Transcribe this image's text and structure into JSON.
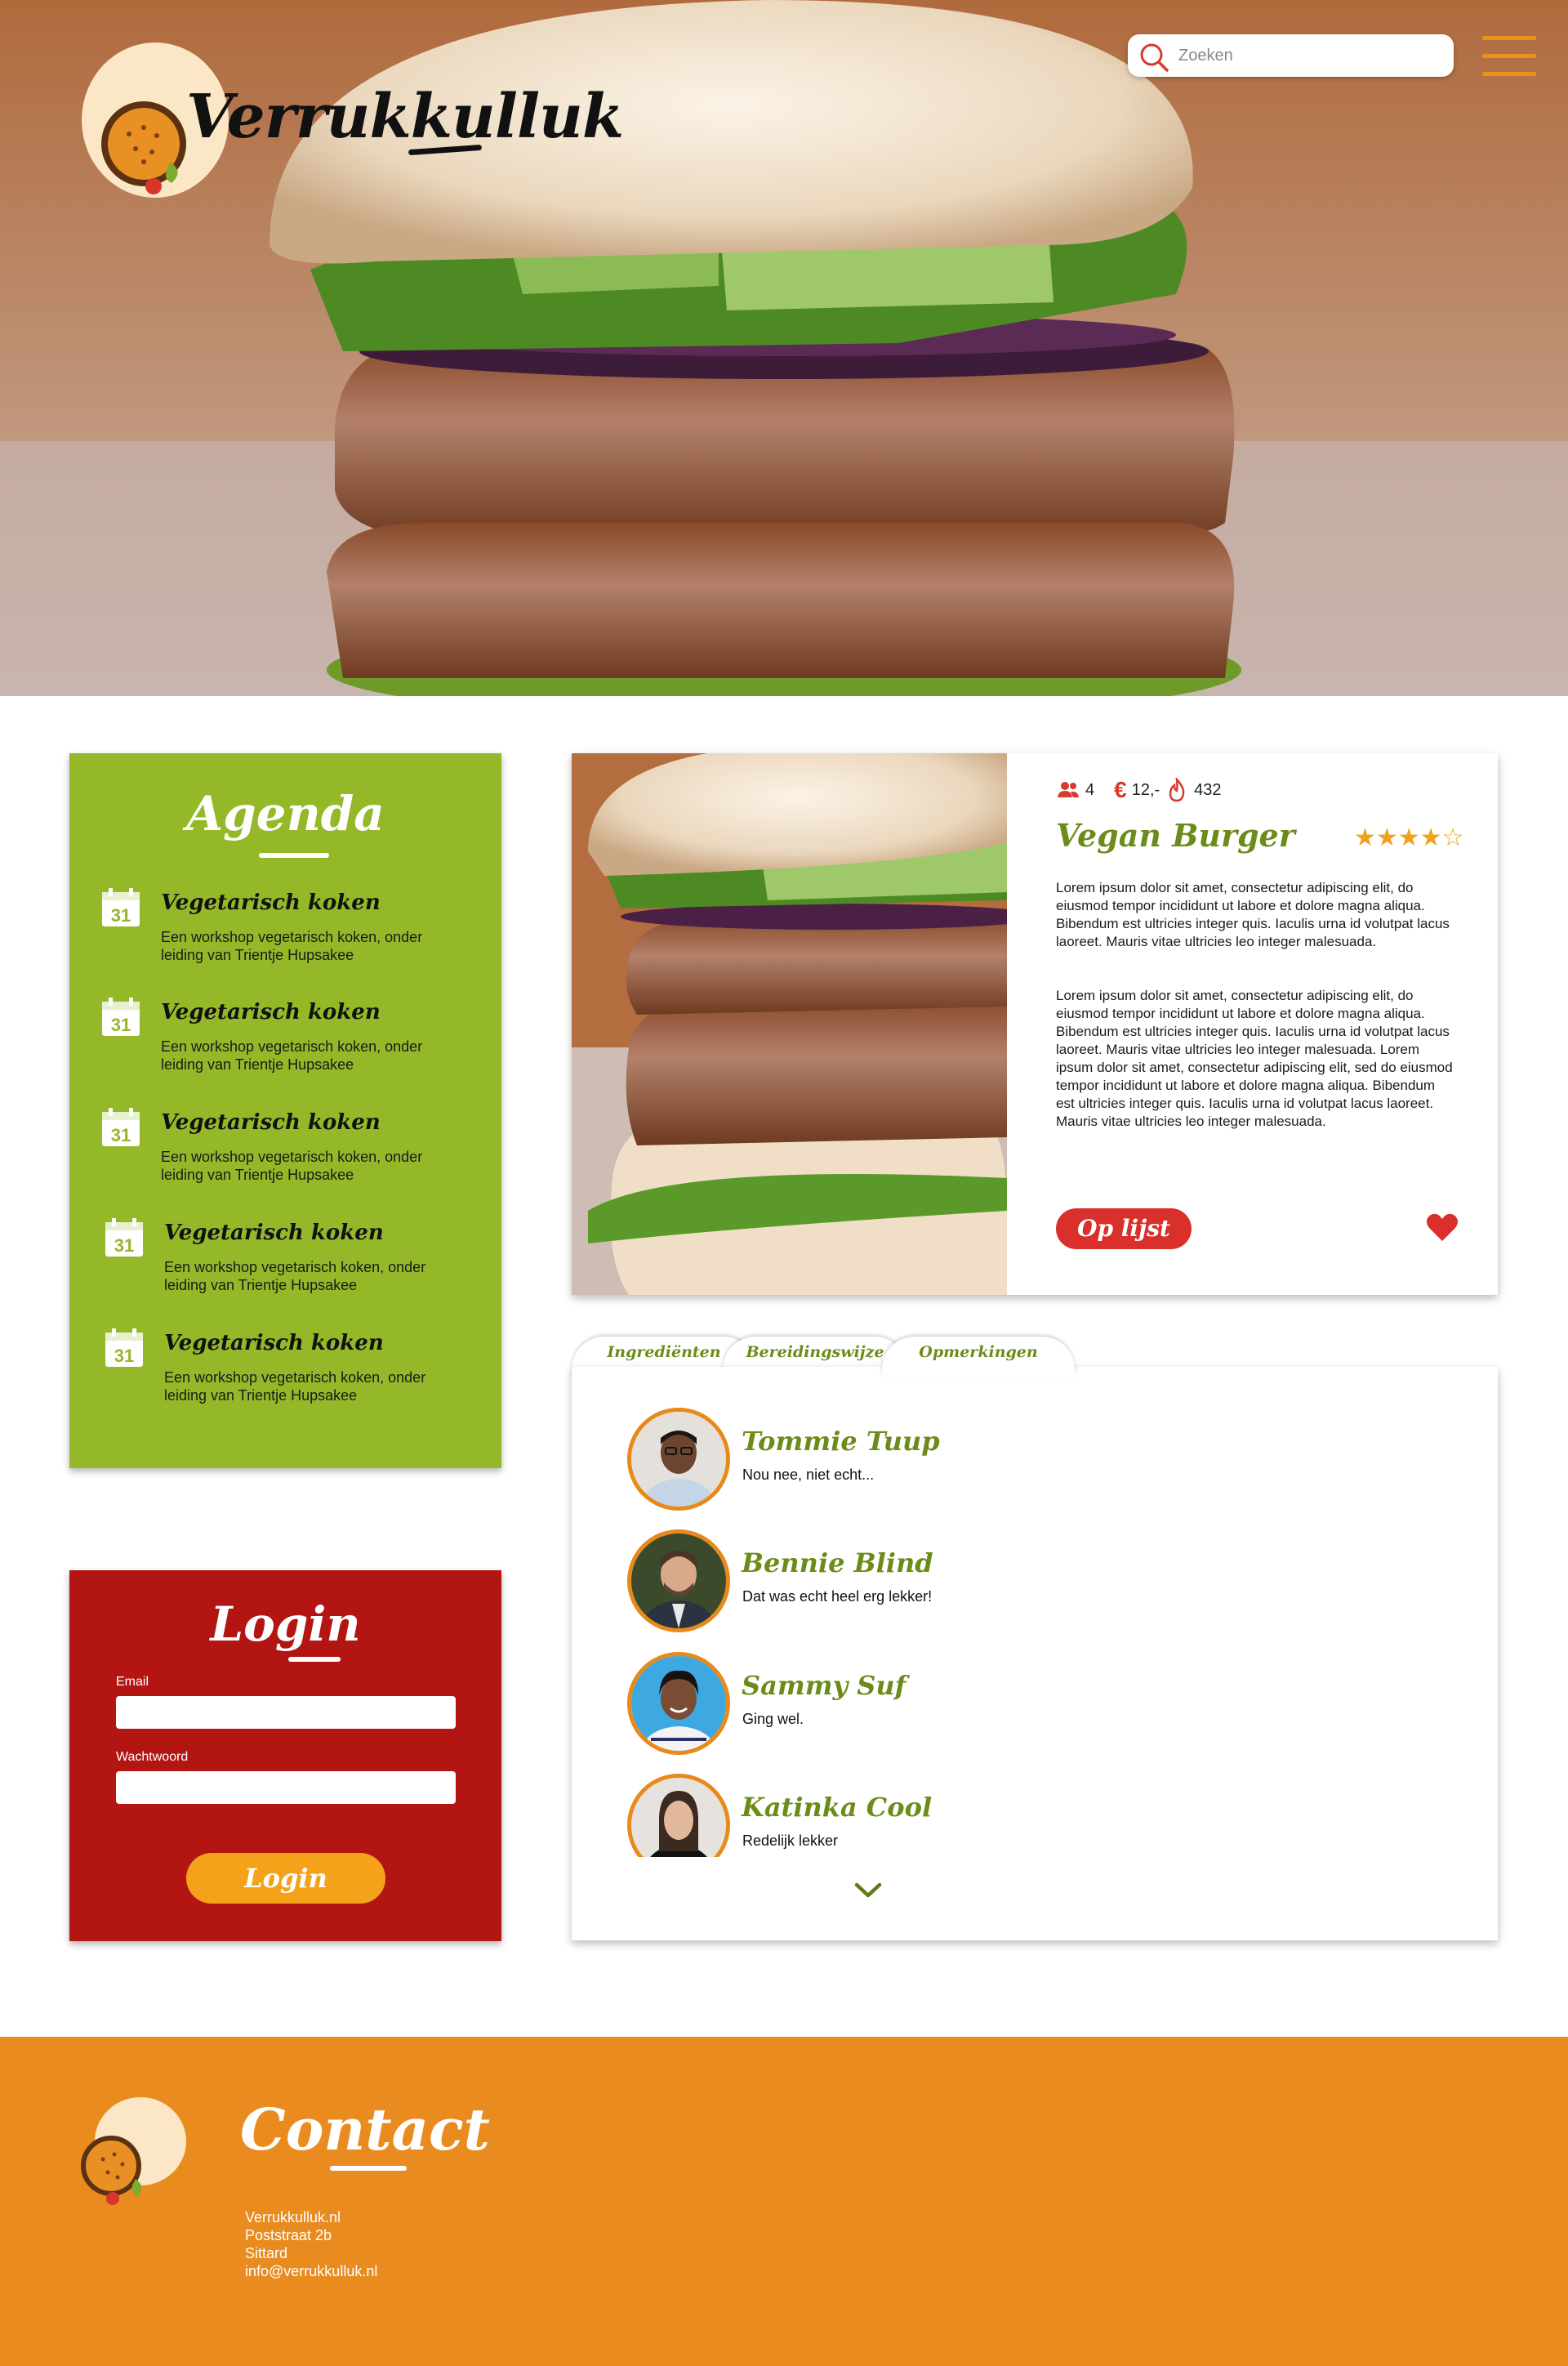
{
  "header": {
    "logo_text": "Verrukkulluk",
    "search_placeholder": "Zoeken"
  },
  "agenda": {
    "title": "Agenda",
    "items": [
      {
        "day": "31",
        "title": "Vegetarisch koken",
        "description": "Een workshop vegetarisch koken, onder leiding van Trientje Hupsakee"
      },
      {
        "day": "31",
        "title": "Vegetarisch koken",
        "description": "Een workshop vegetarisch koken, onder leiding van Trientje Hupsakee"
      },
      {
        "day": "31",
        "title": "Vegetarisch koken",
        "description": "Een workshop vegetarisch koken, onder leiding van Trientje Hupsakee"
      },
      {
        "day": "31",
        "title": "Vegetarisch koken",
        "description": "Een workshop vegetarisch koken, onder leiding van Trientje Hupsakee"
      },
      {
        "day": "31",
        "title": "Vegetarisch koken",
        "description": "Een workshop vegetarisch koken, onder leiding van Trientje Hupsakee"
      }
    ]
  },
  "login": {
    "title": "Login",
    "email_label": "Email",
    "password_label": "Wachtwoord",
    "button_label": "Login"
  },
  "recipe": {
    "persons": "4",
    "price": "12,-",
    "calories": "432",
    "title": "Vegan Burger",
    "rating": "★★★★☆",
    "rating_value": 4,
    "paragraph_1": "Lorem ipsum dolor sit amet, consectetur adipiscing elit, do eiusmod tempor incididunt ut labore et dolore magna aliqua. Bibendum est ultricies integer quis. Iaculis urna id volutpat lacus laoreet. Mauris vitae ultricies leo integer malesuada.",
    "paragraph_2": "Lorem ipsum dolor sit amet, consectetur adipiscing elit, do eiusmod tempor incididunt ut labore et dolore magna aliqua. Bibendum est ultricies integer quis. Iaculis urna id volutpat lacus laoreet. Mauris vitae ultricies leo integer malesuada. Lorem ipsum dolor sit amet, consectetur adipiscing elit, sed do eiusmod tempor incididunt ut labore et dolore magna aliqua. Bibendum est ultricies integer quis. Iaculis urna id volutpat lacus laoreet. Mauris vitae ultricies leo integer malesuada.",
    "add_button": "Op lijst"
  },
  "tabs": [
    "Ingrediënten",
    "Bereidingswijze",
    "Opmerkingen"
  ],
  "comments": [
    {
      "name": "Tommie Tuup",
      "text": "Nou nee, niet echt..."
    },
    {
      "name": "Bennie Blind",
      "text": "Dat was echt heel erg lekker!"
    },
    {
      "name": "Sammy Suf",
      "text": "Ging wel."
    },
    {
      "name": "Katinka Cool",
      "text": "Redelijk lekker"
    }
  ],
  "footer": {
    "title": "Contact",
    "site": "Verrukkulluk.nl",
    "street": "Poststraat 2b",
    "city": "Sittard",
    "email": "info@verrukkulluk.nl"
  },
  "colors": {
    "orange": "#ea8b20",
    "green": "#95b829",
    "red": "#b31512",
    "title_green": "#6c8c1a",
    "accent_red": "#d9302b"
  }
}
